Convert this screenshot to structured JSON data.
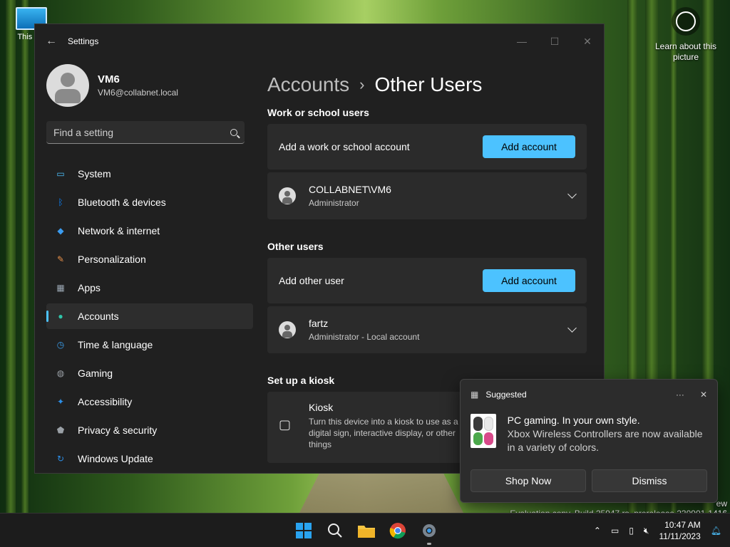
{
  "desktop": {
    "this_pc_label": "This PC",
    "learn_label": "Learn about this picture",
    "watermark": "Evaluation copy. Build 25947.rs_prerelease.230901-1416",
    "watermark_top": "ew"
  },
  "window": {
    "title": "Settings",
    "controls": {
      "minimize": "—",
      "maximize": "☐",
      "close": "✕"
    }
  },
  "profile": {
    "name": "VM6",
    "email": "VM6@collabnet.local"
  },
  "search": {
    "placeholder": "Find a setting"
  },
  "nav": [
    {
      "label": "System",
      "icon": "system-icon",
      "color": "#4cc2ff"
    },
    {
      "label": "Bluetooth & devices",
      "icon": "bluetooth-icon",
      "color": "#0a84ff"
    },
    {
      "label": "Network & internet",
      "icon": "network-icon",
      "color": "#3b9cf0"
    },
    {
      "label": "Personalization",
      "icon": "brush-icon",
      "color": "#e8914a"
    },
    {
      "label": "Apps",
      "icon": "apps-icon",
      "color": "#9aa6b2"
    },
    {
      "label": "Accounts",
      "icon": "accounts-icon",
      "color": "#2fc4a8",
      "active": true
    },
    {
      "label": "Time & language",
      "icon": "time-language-icon",
      "color": "#3aa0f0"
    },
    {
      "label": "Gaming",
      "icon": "gaming-icon",
      "color": "#9aa0a6"
    },
    {
      "label": "Accessibility",
      "icon": "accessibility-icon",
      "color": "#2c8fe8"
    },
    {
      "label": "Privacy & security",
      "icon": "shield-icon",
      "color": "#9aa0a6"
    },
    {
      "label": "Windows Update",
      "icon": "update-icon",
      "color": "#2c8fe8"
    }
  ],
  "main": {
    "breadcrumb_parent": "Accounts",
    "breadcrumb_current": "Other Users",
    "work_section": "Work or school users",
    "work_add_label": "Add a work or school account",
    "work_add_button": "Add account",
    "work_user": {
      "name": "COLLABNET\\VM6",
      "role": "Administrator"
    },
    "other_section": "Other users",
    "other_add_label": "Add other user",
    "other_add_button": "Add account",
    "other_user": {
      "name": "fartz",
      "role": "Administrator - Local account"
    },
    "kiosk_section": "Set up a kiosk",
    "kiosk_title": "Kiosk",
    "kiosk_desc": "Turn this device into a kiosk to use as a digital sign, interactive display, or other things"
  },
  "toast": {
    "source": "Suggested",
    "more": "···",
    "close": "✕",
    "headline": "PC gaming. In your own style.",
    "body": "Xbox Wireless Controllers are now available in a variety of colors.",
    "primary": "Shop Now",
    "secondary": "Dismiss"
  },
  "taskbar": {
    "apps": [
      "start-icon",
      "search-icon",
      "file-explorer-icon",
      "chrome-icon",
      "settings-gear-icon"
    ],
    "time": "10:47 AM",
    "date": "11/11/2023"
  },
  "colors": {
    "accent": "#4cc2ff",
    "window_bg": "#202020",
    "card_bg": "#2b2b2b"
  }
}
